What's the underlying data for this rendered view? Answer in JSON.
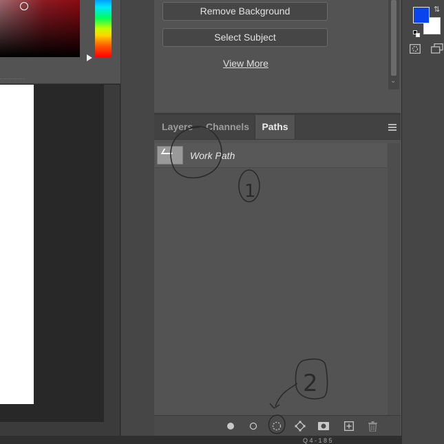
{
  "colors": {
    "foreground": "#0a44ee",
    "background": "#ffffff",
    "panel_bg": "#535353",
    "canvas_bg": "#282828",
    "annotation_ink": "#2a2a2a"
  },
  "properties": {
    "remove_background_label": "Remove Background",
    "select_subject_label": "Select Subject",
    "view_more_label": "View More"
  },
  "tabs": [
    {
      "label": "Layers",
      "active": false
    },
    {
      "label": "Channels",
      "active": false
    },
    {
      "label": "Paths",
      "active": true
    }
  ],
  "paths": [
    {
      "name": "Work Path"
    }
  ],
  "annotations": {
    "marker_1": "1",
    "marker_2": "2"
  },
  "status_text": "Q 4 - 1 8 5",
  "icons": {
    "fill_path": "fill-path-icon",
    "stroke_path": "stroke-path-icon",
    "load_selection": "load-path-as-selection-icon",
    "make_path": "make-work-path-icon",
    "add_mask": "add-mask-icon",
    "new_path": "new-path-icon",
    "delete_path": "trash-icon",
    "panel_menu": "hamburger-menu-icon"
  }
}
